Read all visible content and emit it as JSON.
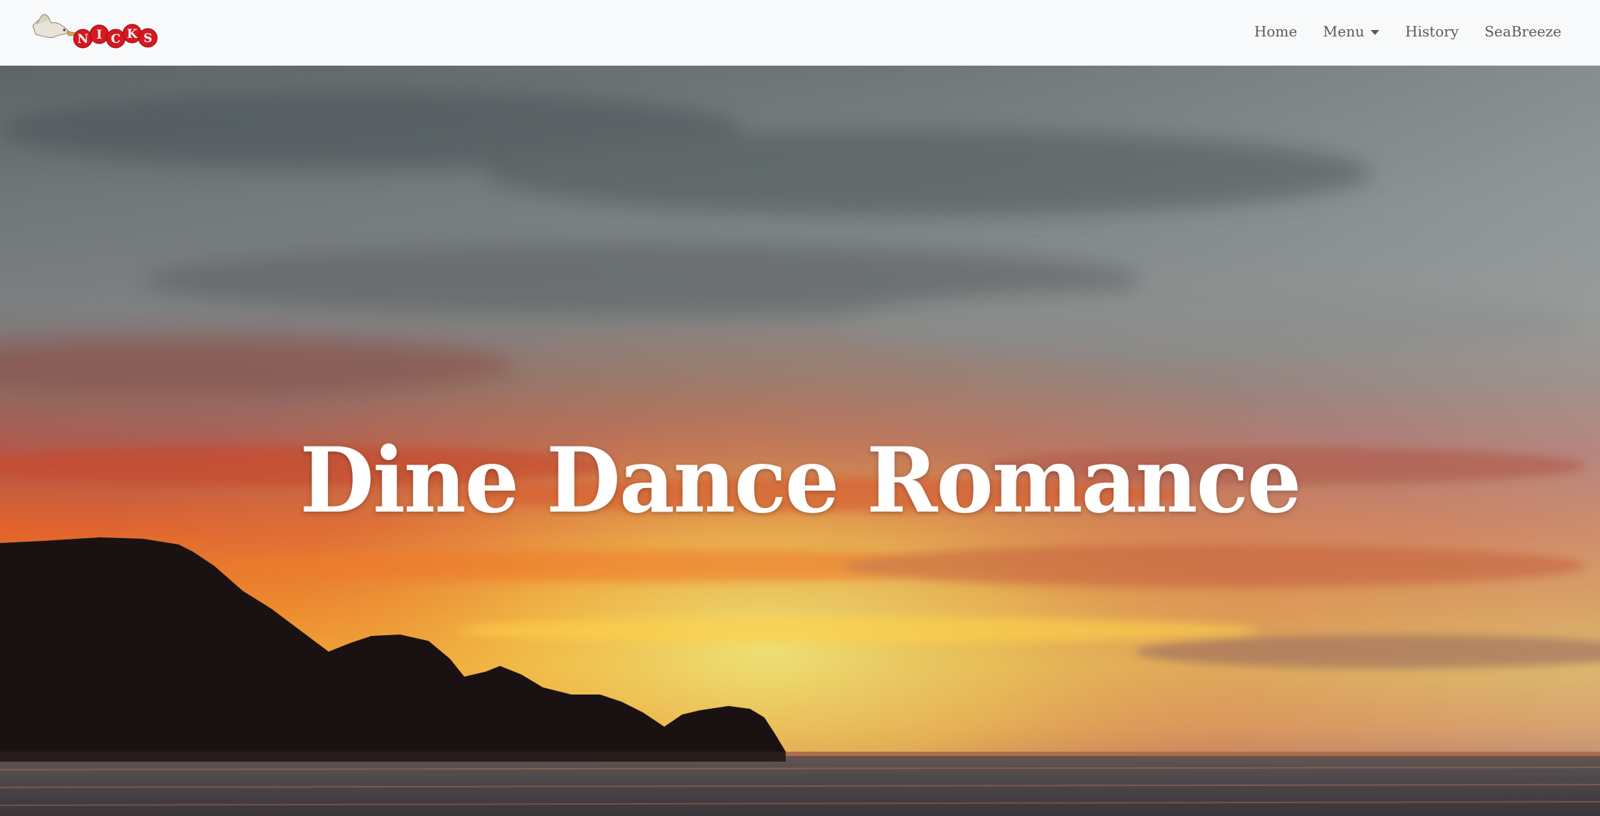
{
  "brand": {
    "logo_text": "NICKS",
    "logo_letters": [
      "N",
      "I",
      "C",
      "K",
      "S"
    ],
    "logo_color": "#d7181f"
  },
  "nav": {
    "items": [
      {
        "label": "Home"
      },
      {
        "label": "Menu",
        "has_dropdown": true
      },
      {
        "label": "History"
      },
      {
        "label": "SeaBreeze"
      }
    ]
  },
  "hero": {
    "heading": "Dine Dance Romance",
    "background": "sunset-over-ocean-with-headland"
  },
  "colors": {
    "navbar_bg": "#f8f9fa",
    "nav_text": "#5a5a5a",
    "heading_text": "#ffffff"
  }
}
